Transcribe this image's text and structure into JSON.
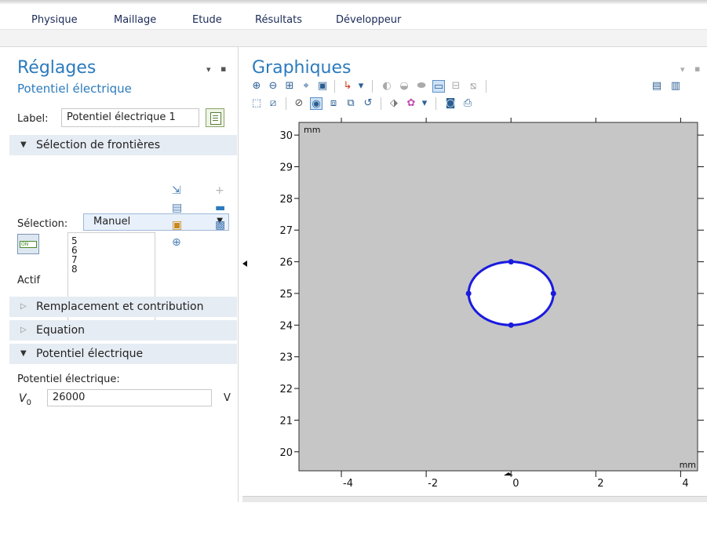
{
  "menu": {
    "items": [
      "Physique",
      "Maillage",
      "Etude",
      "Résultats",
      "Développeur"
    ]
  },
  "settings": {
    "title": "Réglages",
    "subtitle": "Potentiel électrique",
    "label_caption": "Label:",
    "label_value": "Potentiel électrique 1",
    "sections": {
      "boundary_selection": "Sélection de frontières",
      "override": "Remplacement et contribution",
      "equation": "Equation",
      "potential": "Potentiel électrique"
    },
    "selection_caption": "Sélection:",
    "selection_value": "Manuel",
    "toggle_text": "ON",
    "active_label": "Actif",
    "boundaries": [
      "5",
      "6",
      "7",
      "8"
    ],
    "potential_caption": "Potentiel électrique:",
    "v0_symbol": "V",
    "v0_subscript": "0",
    "v0_value": "26000",
    "v0_unit": "V"
  },
  "graphics": {
    "title": "Graphiques",
    "toolbar_row1": [
      "zoom-in-icon",
      "zoom-out-icon",
      "zoom-box-icon",
      "zoom-selected-icon",
      "zoom-extents-icon",
      "axis-orientation-icon",
      "scene-light-icon",
      "transparency-icon",
      "wireframe-icon",
      "render-mode-icon",
      "grid-icon",
      "hide-icon",
      "print-icon",
      "screenshot-icon"
    ],
    "toolbar_row2": [
      "select-box-icon",
      "deselect-icon",
      "hide-geom-icon",
      "show-geom-icon",
      "hidden-objects-icon",
      "view-edit-icon",
      "reset-icon",
      "camera-views-icon",
      "color-palette-icon",
      "image-snapshot-icon",
      "print-image-icon"
    ],
    "plot": {
      "xlim": [
        -5,
        4.4
      ],
      "ylim": [
        19.4,
        30.4
      ],
      "x_ticks": [
        "-4",
        "-2",
        "0",
        "2",
        "4"
      ],
      "y_ticks": [
        "20",
        "21",
        "22",
        "23",
        "24",
        "25",
        "26",
        "27",
        "28",
        "29",
        "30"
      ],
      "y_unit": "mm",
      "x_unit": "mm",
      "circle": {
        "center_x": 0,
        "center_y": 25,
        "radius": 1.0,
        "color": "#1a1adf"
      },
      "background_color": "#c6c6c6"
    }
  }
}
